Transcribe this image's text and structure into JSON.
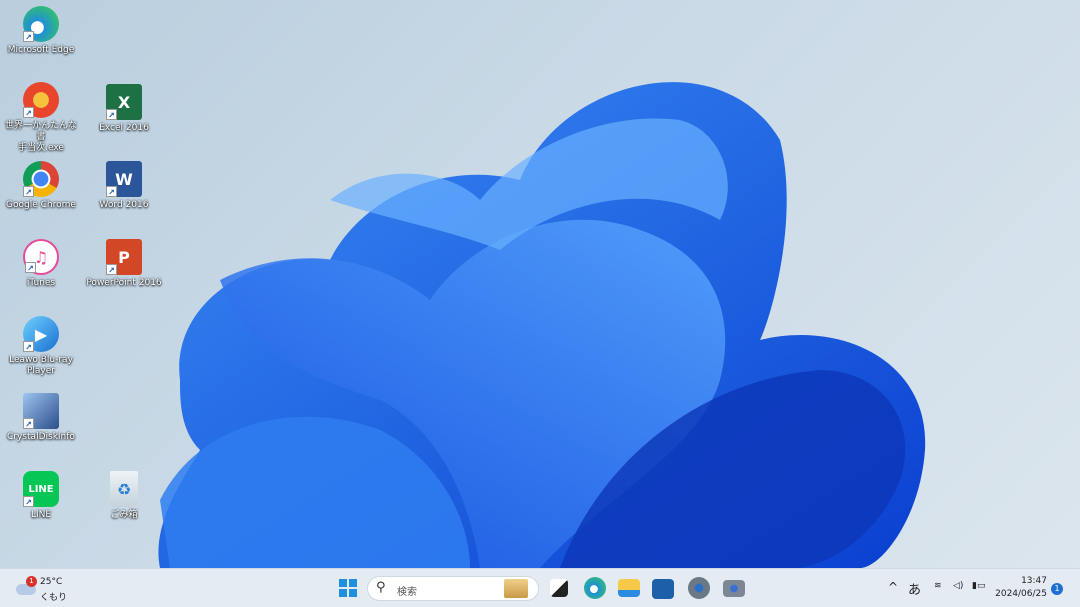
{
  "desktop": {
    "icons": [
      {
        "label": "Microsoft Edge",
        "icon": "edge-icon",
        "color": "#1e8fd8"
      },
      {
        "label": "世界一かんたんな書\n手当次.exe",
        "icon": "app-spinning-top-icon",
        "color": "#e8452c"
      },
      {
        "label": "Excel 2016",
        "icon": "excel-icon",
        "color": "#1e7145",
        "glyph": "X"
      },
      {
        "label": "Google Chrome",
        "icon": "chrome-icon",
        "color": "#db4437"
      },
      {
        "label": "Word 2016",
        "icon": "word-icon",
        "color": "#2b579a",
        "glyph": "W"
      },
      {
        "label": "iTunes",
        "icon": "itunes-icon",
        "color": "#e84a9a",
        "glyph": "♫"
      },
      {
        "label": "PowerPoint 2016",
        "icon": "powerpoint-icon",
        "color": "#d24726",
        "glyph": "P"
      },
      {
        "label": "Leawo Blu-ray\nPlayer",
        "icon": "leawo-player-icon",
        "color": "#1aa0e0",
        "glyph": "▶"
      },
      {
        "label": "CrystalDiskInfo",
        "icon": "crystaldiskinfo-icon",
        "color": "#4a6fa8"
      },
      {
        "label": "LINE",
        "icon": "line-icon",
        "color": "#06c755",
        "glyph": "LINE"
      },
      {
        "label": "ごみ箱",
        "icon": "recycle-bin-icon",
        "color": "#d8e2ea",
        "glyph": "♻"
      }
    ]
  },
  "taskbar": {
    "weather": {
      "temp": "25°C",
      "condition": "くもり",
      "badge": "1"
    },
    "search_placeholder": "検索",
    "apps": [
      "task-view",
      "edge",
      "file-explorer",
      "microsoft-store",
      "settings",
      "camera"
    ],
    "tray": {
      "ime": "あ",
      "time": "13:47",
      "date": "2024/06/25",
      "notification_count": "1"
    }
  }
}
